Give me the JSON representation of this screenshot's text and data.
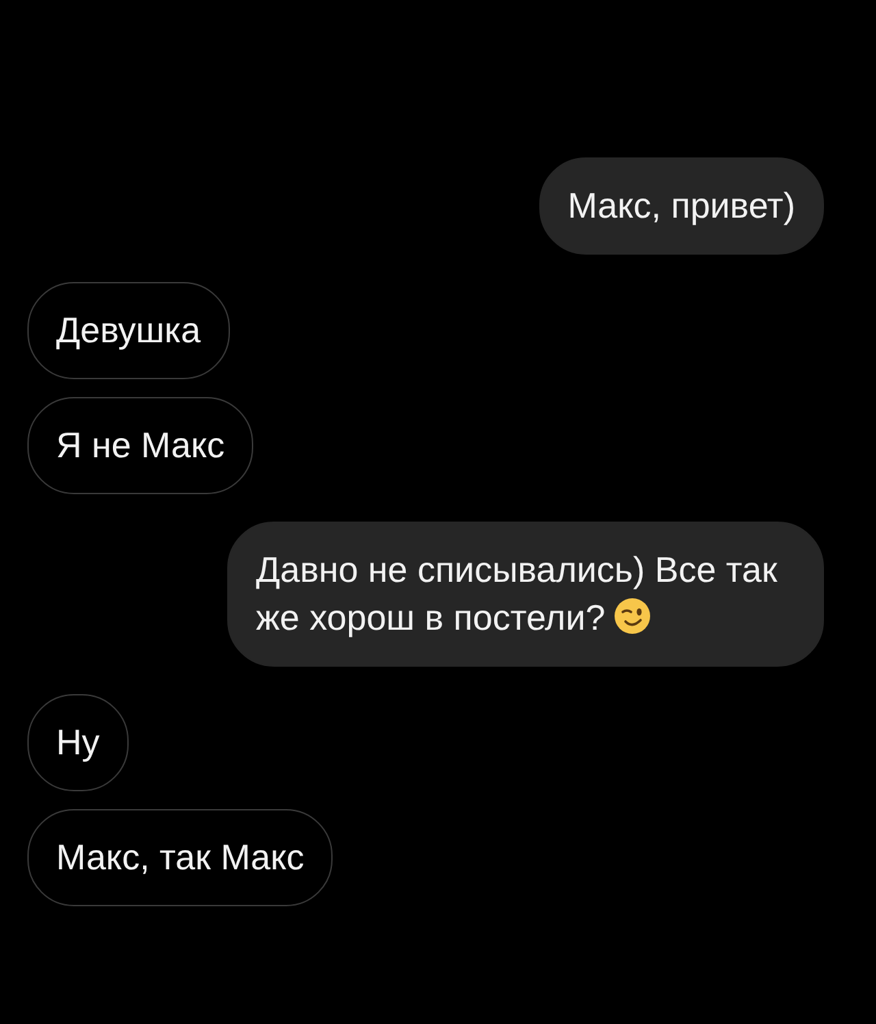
{
  "messages": [
    {
      "kind": "outgoing",
      "text": "Макс, привет)"
    },
    {
      "kind": "incoming",
      "text": "Девушка"
    },
    {
      "kind": "incoming",
      "text": "Я не Макс"
    },
    {
      "kind": "outgoing",
      "text": "Давно не списывались) Все так же хорош в постели?",
      "has_emoji": true
    },
    {
      "kind": "incoming",
      "text": "Ну"
    },
    {
      "kind": "incoming",
      "text": "Макс, так Макс"
    }
  ]
}
